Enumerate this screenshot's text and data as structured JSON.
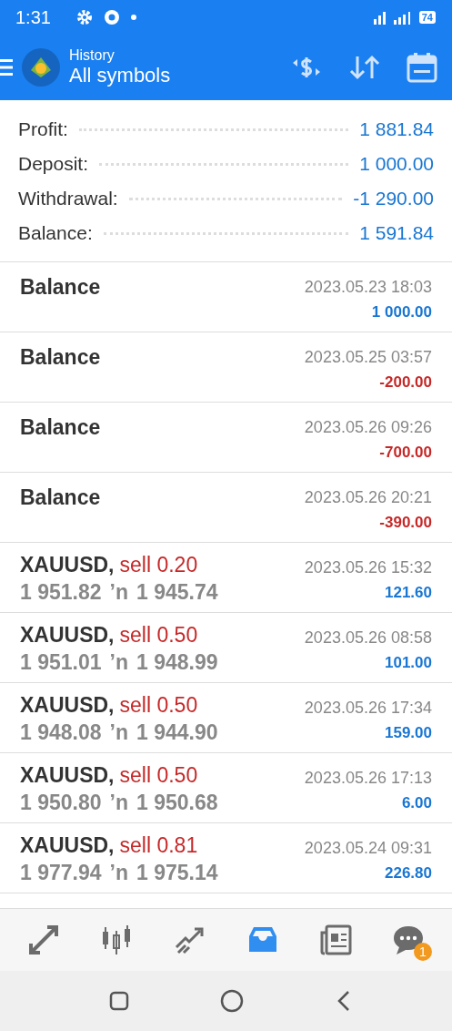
{
  "status_bar": {
    "time": "1:31",
    "battery": "74"
  },
  "header": {
    "title": "History",
    "subtitle": "All symbols"
  },
  "summary": [
    {
      "label": "Profit:",
      "value": "1 881.84"
    },
    {
      "label": "Deposit:",
      "value": "1 000.00"
    },
    {
      "label": "Withdrawal:",
      "value": "-1 290.00"
    },
    {
      "label": "Balance:",
      "value": "1 591.84"
    }
  ],
  "entries": [
    {
      "kind": "balance",
      "title": "Balance",
      "time": "2023.05.23 18:03",
      "amount": "1 000.00",
      "negative": false
    },
    {
      "kind": "balance",
      "title": "Balance",
      "time": "2023.05.25 03:57",
      "amount": "-200.00",
      "negative": true
    },
    {
      "kind": "balance",
      "title": "Balance",
      "time": "2023.05.26 09:26",
      "amount": "-700.00",
      "negative": true
    },
    {
      "kind": "balance",
      "title": "Balance",
      "time": "2023.05.26 20:21",
      "amount": "-390.00",
      "negative": true
    },
    {
      "kind": "trade",
      "symbol": "XAUUSD,",
      "side": "sell 0.20",
      "open": "1 951.82",
      "arrow": "ʼn",
      "close": "1 945.74",
      "time": "2023.05.26 15:32",
      "amount": "121.60",
      "negative": false
    },
    {
      "kind": "trade",
      "symbol": "XAUUSD,",
      "side": "sell 0.50",
      "open": "1 951.01",
      "arrow": "ʼn",
      "close": "1 948.99",
      "time": "2023.05.26 08:58",
      "amount": "101.00",
      "negative": false
    },
    {
      "kind": "trade",
      "symbol": "XAUUSD,",
      "side": "sell 0.50",
      "open": "1 948.08",
      "arrow": "ʼn",
      "close": "1 944.90",
      "time": "2023.05.26 17:34",
      "amount": "159.00",
      "negative": false
    },
    {
      "kind": "trade",
      "symbol": "XAUUSD,",
      "side": "sell 0.50",
      "open": "1 950.80",
      "arrow": "ʼn",
      "close": "1 950.68",
      "time": "2023.05.26 17:13",
      "amount": "6.00",
      "negative": false
    },
    {
      "kind": "trade",
      "symbol": "XAUUSD,",
      "side": "sell 0.81",
      "open": "1 977.94",
      "arrow": "ʼn",
      "close": "1 975.14",
      "time": "2023.05.24 09:31",
      "amount": "226.80",
      "negative": false
    }
  ],
  "bottom_nav": [
    {
      "kind": "quotes",
      "selected": false
    },
    {
      "kind": "chart",
      "selected": false
    },
    {
      "kind": "trade",
      "selected": false
    },
    {
      "kind": "history",
      "selected": true
    },
    {
      "kind": "news",
      "selected": false
    },
    {
      "kind": "chat",
      "selected": false,
      "badge": "1"
    }
  ]
}
